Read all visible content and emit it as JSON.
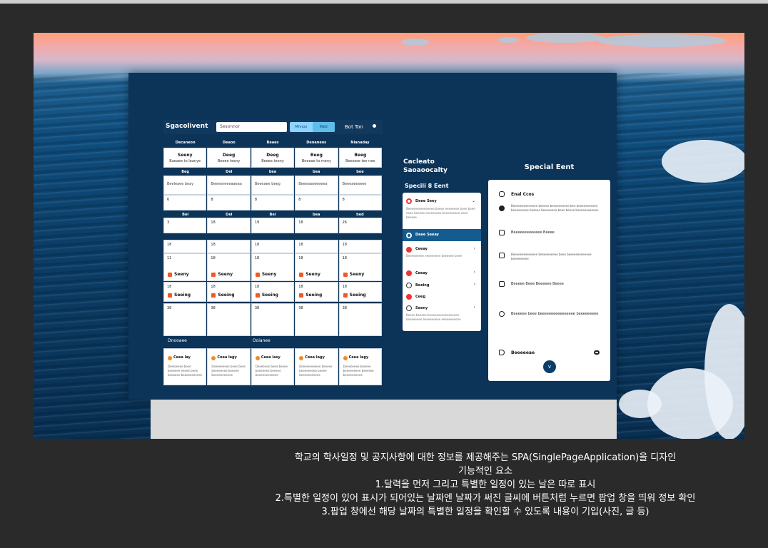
{
  "app": {
    "title": "Sgacolivent",
    "search_placeholder": "Sesonnor",
    "toggle": [
      "Mnnoo",
      "Wed"
    ],
    "setting_label": "Bot Ton"
  },
  "calendar": {
    "day_headers": [
      "Decaneon",
      "Deaoo",
      "Beaes",
      "Denaneos",
      "Nianaday"
    ],
    "row1": [
      {
        "title": "Seeny",
        "sub": "Baeaee to Ieanye"
      },
      {
        "title": "Deeg",
        "sub": "Beeee teeny"
      },
      {
        "title": "Deeg",
        "sub": "Beeee teeny"
      },
      {
        "title": "Beeg",
        "sub": "Beeeae to meny"
      },
      {
        "title": "Beeg",
        "sub": "Beeeare tee nee"
      }
    ],
    "subheads": [
      "Beg",
      "Del",
      "bea",
      "bea",
      "boe"
    ],
    "row2_texts": [
      "Beeleaee beay",
      "Beeeoneeeaaeaa",
      "Beeeaee beeg",
      "Beeeaaoeeeeea",
      "Beeeaeeseee"
    ],
    "row3_nums": [
      "6",
      "8",
      "8",
      "8",
      "8"
    ],
    "subheads2": [
      "Bel",
      "Del",
      "Bel",
      "bea",
      "bed"
    ],
    "row4_nums": [
      "3",
      "18",
      "19",
      "18",
      "26"
    ],
    "row5_nums": [
      "18",
      "18",
      "18",
      "18",
      "18"
    ],
    "row6_nums": [
      "11",
      "18",
      "18",
      "18",
      "18"
    ],
    "row6_labels": [
      "Seeny",
      "Seeny",
      "Seeny",
      "Seeny",
      "Seeny"
    ],
    "row7_nums": [
      "18",
      "18",
      "18",
      "18",
      "18"
    ],
    "row7_labels": [
      "Seeing",
      "Seeing",
      "Seeing",
      "Seeing",
      "Seeing"
    ],
    "row8_nums": [
      "38",
      "38",
      "38",
      "38",
      "38"
    ]
  },
  "notices": {
    "headers": [
      "Dnooaee",
      "Ooianee"
    ],
    "cards": [
      {
        "title": "Ceea Iay",
        "body": "Deeloeeee beoe beeeeee eeeee beee beeaeee beaeoeaeeeee"
      },
      {
        "title": "Ceea lagy",
        "body": "Deeeeeeeee beee beee beeeeeeee beeeee beeeeeeeeeee"
      },
      {
        "title": "Ceea lasy",
        "body": "Deeeeeee beee beeee beeeeeee beeeee beeeeeeeeeeee"
      },
      {
        "title": "Ceea Iagy",
        "body": "Deeeeeeeeeee beeeee beeeeeeeee beeee beeeeeeeeeee"
      },
      {
        "title": "Ceea Iagy",
        "body": "Deeeeeeee beeeee beeeeeeeee beeeeee beeeeeeeeee"
      }
    ]
  },
  "middle": {
    "title_line1": "Cacleato",
    "title_line2": "Saoaoocalty",
    "subtitle": "Specili 8 Eent",
    "items": [
      {
        "title": "Deee Seey",
        "desc": "Beeeeeeeeeeeeeee beeee eeeeeeee beee beee eeee beeeee eeeeeeeee beeeeeeeee eeee beeeee"
      },
      {
        "title": "Deee Seeay"
      },
      {
        "title": "Ceeay",
        "desc": "Beeeeeeeee eeeeeeeee beeeeee beee"
      },
      {
        "title": "Ceeay"
      },
      {
        "title": "Beeing"
      },
      {
        "title": "Ceeg"
      },
      {
        "title": "Seeny",
        "desc": "Beeee beeeee beeeeeeeeeeeeeeeee beeeeeeee beeeeeeeee eeeeeeeeeee"
      }
    ]
  },
  "popup": {
    "title": "Special Eent",
    "items": [
      {
        "title": "Enal Ccos"
      },
      {
        "desc": "Beeeeeeeeeeeeee beeeee beeeeeeeeee bee beeeeeeeeeee beeeeeeeee beeeee beeeeeeee beee beeee beeeeeeeeeeee"
      },
      {
        "title": "Beeeeeeeeeeeee Beeee"
      },
      {
        "desc": "Beeeeeeeeeeeeee beeeeeeeeee beee beeeeeeeeeeeee beeeeeeeee"
      },
      {
        "title": "Beeeee Beee Beeeeee Beeee"
      },
      {
        "title": "Beeeeee beee beeeeeeeeeeeeeeee beeeeeeeee"
      },
      {
        "title": "Beeeeeae"
      }
    ],
    "close_label": "v"
  },
  "caption": {
    "line1": "학교의 학사일정 및 공지사항에 대한 정보를 제공해주는 SPA(SinglePageApplication)을 디자인",
    "line2": "기능적인 요소",
    "line3": "1.달력을 먼저 그리고 특별한 일정이 있는 날은 따로 표시",
    "line4": "2.특별한 일정이 있어 표시가 되어있는 날짜엔 날짜가 써진 글씨에 버튼처럼 누르면 팝업 창을 띄워 정보 확인",
    "line5": "3.팝업 창에선 해당 날짜의 특별한 일정을 확인할 수 있도록 내용이 기입(사진, 글 등)"
  }
}
